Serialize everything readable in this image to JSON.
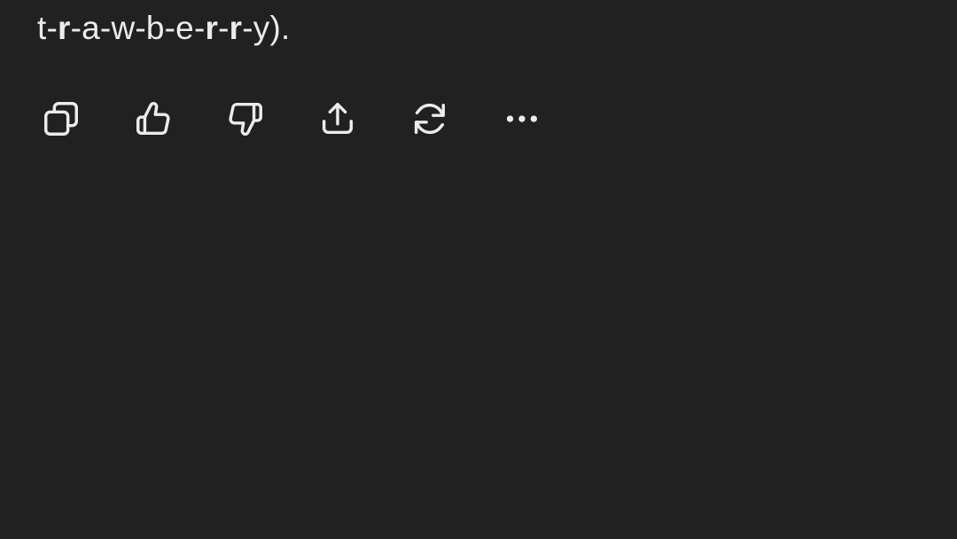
{
  "message": {
    "segments": [
      {
        "text": "t-",
        "bold": false
      },
      {
        "text": "r",
        "bold": true
      },
      {
        "text": "-a-w-b-e-",
        "bold": false
      },
      {
        "text": "r",
        "bold": true
      },
      {
        "text": "-",
        "bold": false
      },
      {
        "text": "r",
        "bold": true
      },
      {
        "text": "-y).",
        "bold": false
      }
    ]
  },
  "actions": [
    {
      "name": "copy-button",
      "icon": "copy-icon"
    },
    {
      "name": "thumbs-up-button",
      "icon": "thumbs-up-icon"
    },
    {
      "name": "thumbs-down-button",
      "icon": "thumbs-down-icon"
    },
    {
      "name": "share-button",
      "icon": "share-icon"
    },
    {
      "name": "regenerate-button",
      "icon": "refresh-icon"
    },
    {
      "name": "more-options-button",
      "icon": "more-horizontal-icon"
    }
  ],
  "theme": {
    "background": "#212121",
    "text": "#ececec",
    "icon": "#ececec"
  }
}
